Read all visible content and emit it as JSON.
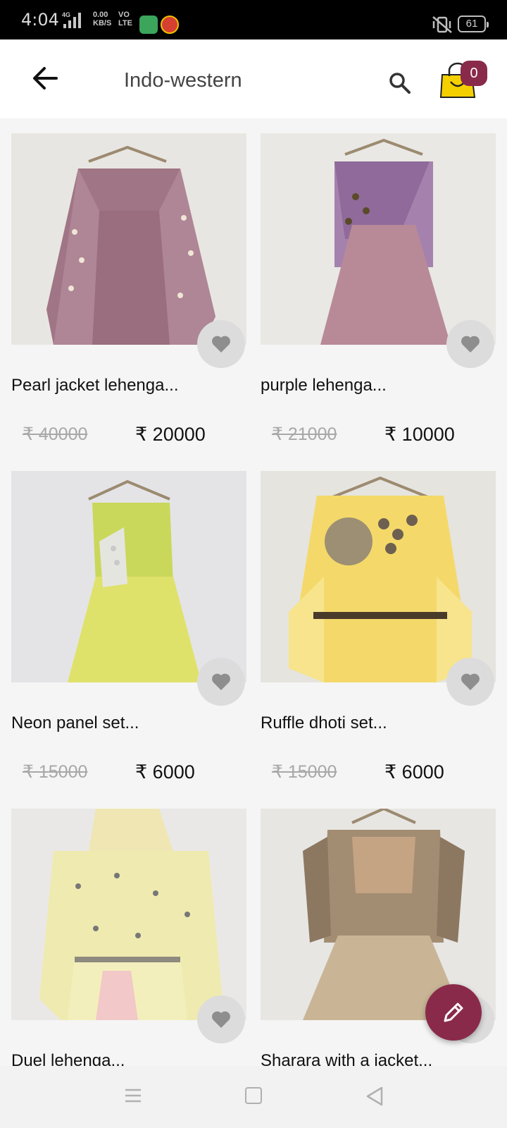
{
  "status_bar": {
    "time": "4:04",
    "network_label": "4G",
    "speed_value": "0.00",
    "speed_unit": "KB/S",
    "volte_top": "VO",
    "volte_bottom": "LTE",
    "battery": "61"
  },
  "app_bar": {
    "title": "Indo-western",
    "cart_count": "0",
    "cart_color": "#f5d000",
    "badge_color": "#8a2a4a"
  },
  "products": [
    {
      "name": "Pearl jacket lehenga...",
      "price_old": "₹ 40000",
      "price_new": "₹ 20000"
    },
    {
      "name": "purple lehenga...",
      "price_old": "₹ 21000",
      "price_new": "₹ 10000"
    },
    {
      "name": "Neon panel set...",
      "price_old": "₹ 15000",
      "price_new": "₹ 6000"
    },
    {
      "name": "Ruffle dhoti set...",
      "price_old": "₹ 15000",
      "price_new": "₹ 6000"
    },
    {
      "name": "Duel lehenga...",
      "price_old": "",
      "price_new": ""
    },
    {
      "name": "Sharara with a jacket...",
      "price_old": "",
      "price_new": ""
    }
  ],
  "icons": {
    "back": "arrow-left-icon",
    "search": "search-icon",
    "cart": "shopping-bag-icon",
    "wishlist": "heart-icon",
    "fab": "pen-icon"
  },
  "colors": {
    "accent": "#8a2a4a",
    "wishlist_bg": "#dcdcdc"
  }
}
